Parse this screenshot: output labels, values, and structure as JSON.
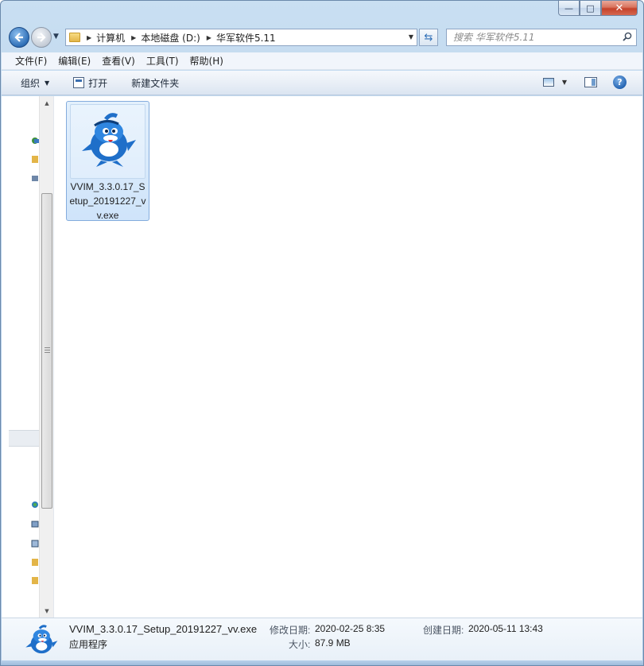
{
  "window": {
    "caption_min": "—",
    "caption_max": "□",
    "caption_close": "✕"
  },
  "address": {
    "crumbs": [
      "计算机",
      "本地磁盘 (D:)",
      "华军软件5.11"
    ]
  },
  "search": {
    "placeholder": "搜索 华军软件5.11"
  },
  "menu": {
    "items": [
      "文件(F)",
      "编辑(E)",
      "查看(V)",
      "工具(T)",
      "帮助(H)"
    ]
  },
  "commands": {
    "organize": "组织",
    "open": "打开",
    "new_folder": "新建文件夹"
  },
  "files": [
    {
      "name": "VVIM_3.3.0.17_Setup_20191227_vv.exe"
    }
  ],
  "details": {
    "file_name": "VVIM_3.3.0.17_Setup_20191227_vv.exe",
    "type": "应用程序",
    "modified_label": "修改日期:",
    "modified_value": "2020-02-25 8:35",
    "created_label": "创建日期:",
    "created_value": "2020-05-11 13:43",
    "size_label": "大小:",
    "size_value": "87.9 MB"
  },
  "colors": {
    "accent": "#2f6fb7",
    "selection": "#cfe4fa"
  }
}
